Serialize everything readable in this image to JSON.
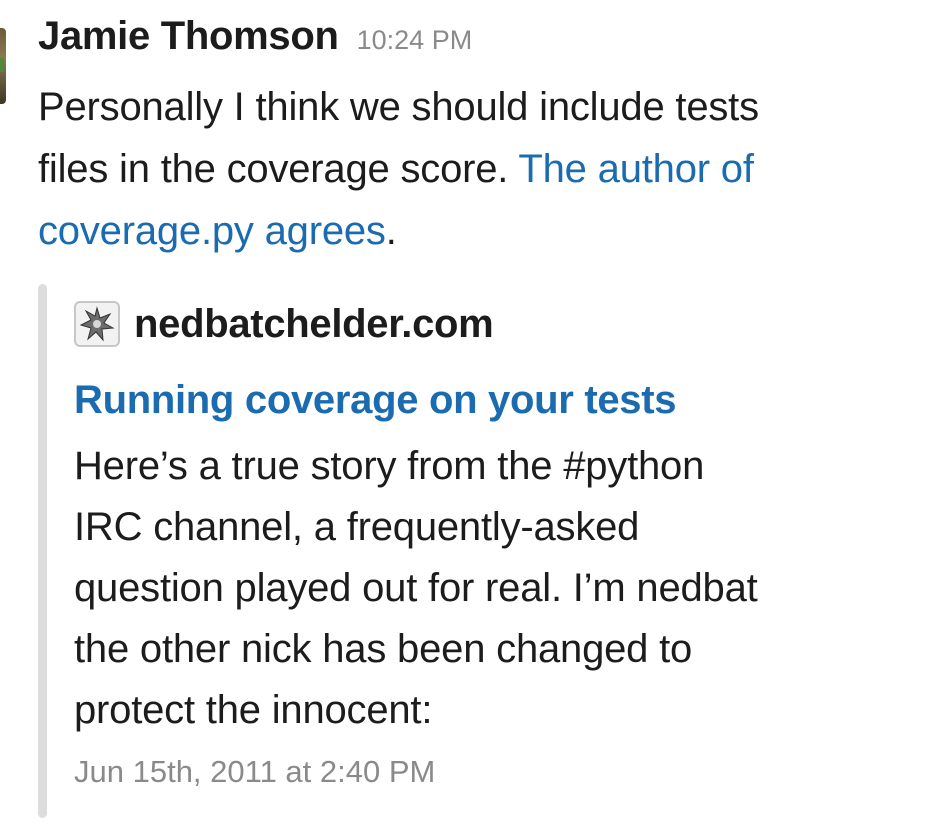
{
  "message": {
    "author": "Jamie Thomson",
    "timestamp": "10:24 PM",
    "lines": [
      "Personally I think we should include tests",
      "files in the coverage score. ",
      "."
    ],
    "link_part_1": "The author of",
    "link_part_2": "coverage.py agrees"
  },
  "attachment": {
    "service_name": "nedbatchelder.com",
    "service_icon": "site-favicon-icon",
    "title": "Running coverage on your tests",
    "text_lines": [
      "Here’s a true story from the #python",
      "IRC channel, a frequently-asked",
      "question played out for real. I’m nedbat",
      "the other nick has been changed to",
      "protect the innocent:"
    ],
    "footer": "Jun 15th, 2011 at 2:40 PM"
  },
  "colors": {
    "link": "#1b6bb0",
    "text": "#1d1c1d",
    "muted": "#8a8a8a",
    "attachment_bar": "#dddddd"
  }
}
